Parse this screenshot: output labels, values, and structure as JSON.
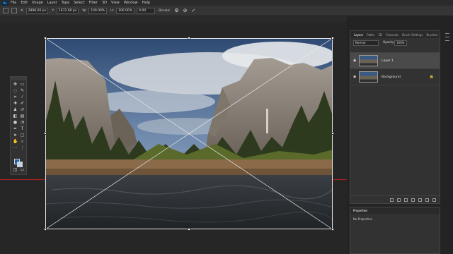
{
  "menubar": {
    "app_logo": "Ps",
    "items": [
      "File",
      "Edit",
      "Image",
      "Layer",
      "Type",
      "Select",
      "Filter",
      "3D",
      "View",
      "Window",
      "Help"
    ]
  },
  "options_bar": {
    "x_label": "X:",
    "x_value": "2898.00 px",
    "y_label": "Y:",
    "y_value": "1672.00 px",
    "w_label": "W:",
    "w_value": "100.00%",
    "h_label": "H:",
    "h_value": "100.00%",
    "angle_value": "0.00",
    "interp": "Bicubic",
    "cancel_icon": "cancel-icon",
    "commit_icon": "commit-check-icon"
  },
  "layers_panel": {
    "tabs": [
      "Layers",
      "Paths",
      "3D",
      "Channels",
      "Brush Settings",
      "Brushes"
    ],
    "blend_mode": "Normal",
    "opacity_label": "Opacity:",
    "opacity_value": "100%",
    "layers": [
      {
        "name": "Layer 1",
        "selected": true
      },
      {
        "name": "Background",
        "selected": false,
        "locked": true
      }
    ]
  },
  "properties_panel": {
    "title": "Properties",
    "empty_text": "No Properties"
  },
  "colors": {
    "foreground": "#1f5fa6",
    "background": "#bcd6ec",
    "guide_line": "#b22222"
  }
}
